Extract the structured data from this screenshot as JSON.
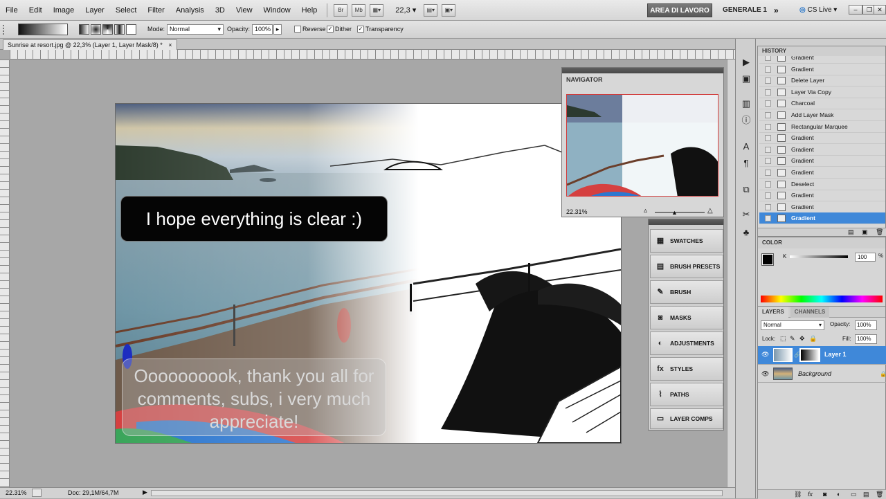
{
  "menu": {
    "items": [
      "File",
      "Edit",
      "Image",
      "Layer",
      "Select",
      "Filter",
      "Analysis",
      "3D",
      "View",
      "Window",
      "Help"
    ],
    "buttons": [
      "Br",
      "Mb"
    ],
    "zoom": "22,3",
    "workspace_active": "AREA DI LAVORO",
    "workspace_other": "GENERALE 1",
    "more": "»",
    "cs_live": "CS Live",
    "win_controls": [
      "–",
      "❐",
      "✕"
    ]
  },
  "options": {
    "mode_label": "Mode:",
    "mode_value": "Normal",
    "opacity_label": "Opacity:",
    "opacity_value": "100%",
    "reverse_label": "Reverse",
    "dither_label": "Dither",
    "transparency_label": "Transparency",
    "reverse_checked": false,
    "dither_checked": true,
    "transparency_checked": true
  },
  "document": {
    "tab_title": "Sunrise at resort.jpg @ 22,3% (Layer 1, Layer Mask/8) *",
    "close": "×",
    "bubble_top": "I hope everything is clear :)",
    "bubble_bottom": "Oooooooook, thank you all for comments, subs, i very much appreciate!"
  },
  "status": {
    "zoom": "22.31%",
    "doc": "Doc: 29,1M/64,7M"
  },
  "navigator": {
    "title": "NAVIGATOR",
    "zoom": "22.31%"
  },
  "panel_list": {
    "items": [
      "SWATCHES",
      "BRUSH PRESETS",
      "BRUSH",
      "MASKS",
      "ADJUSTMENTS",
      "STYLES",
      "PATHS",
      "LAYER COMPS"
    ]
  },
  "history": {
    "title": "HISTORY",
    "items": [
      "Gradient",
      "Gradient",
      "Delete Layer",
      "Layer Via Copy",
      "Charcoal",
      "Add Layer Mask",
      "Rectangular Marquee",
      "Gradient",
      "Gradient",
      "Gradient",
      "Gradient",
      "Deselect",
      "Gradient",
      "Gradient",
      "Gradient"
    ],
    "active_index": 14
  },
  "color": {
    "title": "COLOR",
    "channel_label": "K",
    "value": "100",
    "unit": "%"
  },
  "layers": {
    "tab_layers": "LAYERS",
    "tab_channels": "CHANNELS",
    "blend_mode": "Normal",
    "opacity_label": "Opacity:",
    "opacity_value": "100%",
    "lock_label": "Lock:",
    "fill_label": "Fill:",
    "fill_value": "100%",
    "rows": [
      {
        "name": "Layer 1",
        "selected": true
      },
      {
        "name": "Background",
        "selected": false
      }
    ]
  },
  "colors": {
    "accent": "#3f88d9",
    "panel_header": "#555555"
  }
}
